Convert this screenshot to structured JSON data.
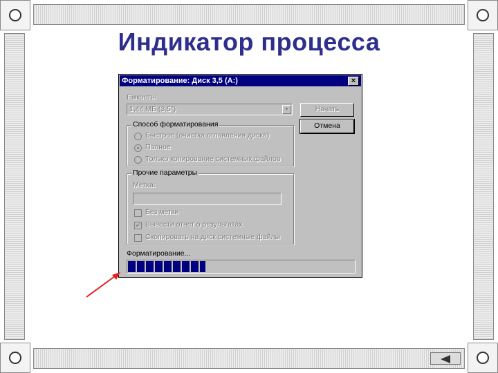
{
  "slide": {
    "title": "Индикатор процесса"
  },
  "dialog": {
    "title": "Форматирование: Диск 3,5 (А:)",
    "close_label": "×",
    "capacity_label": "Емкость:",
    "capacity_value": "1,44 МБ (3,5\")",
    "buttons": {
      "start": "Начать",
      "cancel": "Отмена"
    },
    "format_group": {
      "legend": "Способ форматирования",
      "options": [
        {
          "label": "Быстрое (очистка оглавления диска)",
          "selected": false
        },
        {
          "label": "Полное",
          "selected": true
        },
        {
          "label": "Только копирование системных файлов",
          "selected": false
        }
      ]
    },
    "other_group": {
      "legend": "Прочие параметры",
      "label_field_label": "Метка:",
      "label_field_value": "",
      "checkboxes": [
        {
          "label": "Без метки",
          "checked": false
        },
        {
          "label": "Вывести отчет о результатах",
          "checked": true
        },
        {
          "label": "Скопировать на диск системные файлы",
          "checked": false
        }
      ]
    },
    "status_text": "Форматирование...",
    "progress_percent": 34
  },
  "colors": {
    "title_text": "#2e2e8c",
    "dialog_title_bar": "#000080",
    "progress_fill": "#000080",
    "pointer_arrow": "#e02020"
  }
}
